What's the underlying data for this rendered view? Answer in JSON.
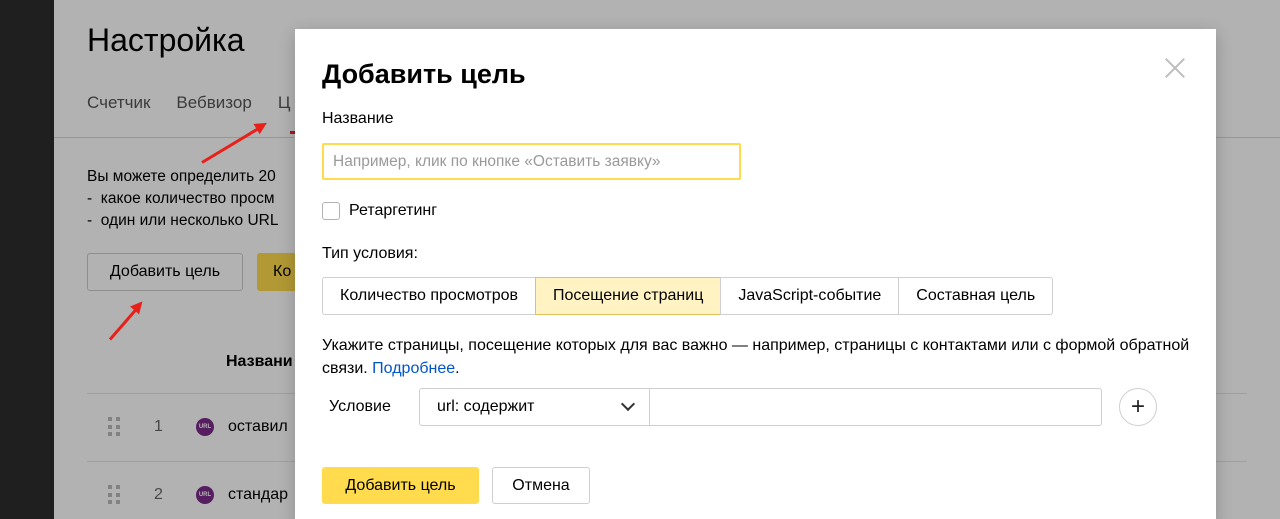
{
  "background": {
    "title": "Настройка",
    "tabs": [
      "Счетчик",
      "Вебвизор",
      "Ц"
    ],
    "description_lines": [
      "Вы можете определить 20",
      "-  какое количество просм",
      "-  один или несколько URL"
    ],
    "add_goal_label": "Добавить цель",
    "yellow_btn_label": "Ко",
    "column_header": "Названи",
    "rows": [
      {
        "num": "1",
        "badge": "URL",
        "name": "оставил"
      },
      {
        "num": "2",
        "badge": "URL",
        "name": "стандар"
      }
    ]
  },
  "modal": {
    "title": "Добавить цель",
    "name_label": "Название",
    "name_placeholder": "Например, клик по кнопке «Оставить заявку»",
    "retargeting_label": "Ретаргетинг",
    "condition_type_label": "Тип условия:",
    "condition_types": [
      {
        "label": "Количество просмотров",
        "active": false
      },
      {
        "label": "Посещение страниц",
        "active": true
      },
      {
        "label": "JavaScript-событие",
        "active": false
      },
      {
        "label": "Составная цель",
        "active": false
      }
    ],
    "hint_text": "Укажите страницы, посещение которых для вас важно — например, страницы с контактами или с формой обратной связи.",
    "hint_link": "Подробнее",
    "condition_label": "Условие",
    "condition_select_value": "url: содержит",
    "condition_input_value": "",
    "add_condition_label": "+",
    "submit_label": "Добавить цель",
    "cancel_label": "Отмена"
  },
  "colors": {
    "accent_yellow": "#ffdb4d",
    "active_segment": "#fff3c4",
    "link": "#0055c9",
    "arrow_red": "#e8201a"
  }
}
